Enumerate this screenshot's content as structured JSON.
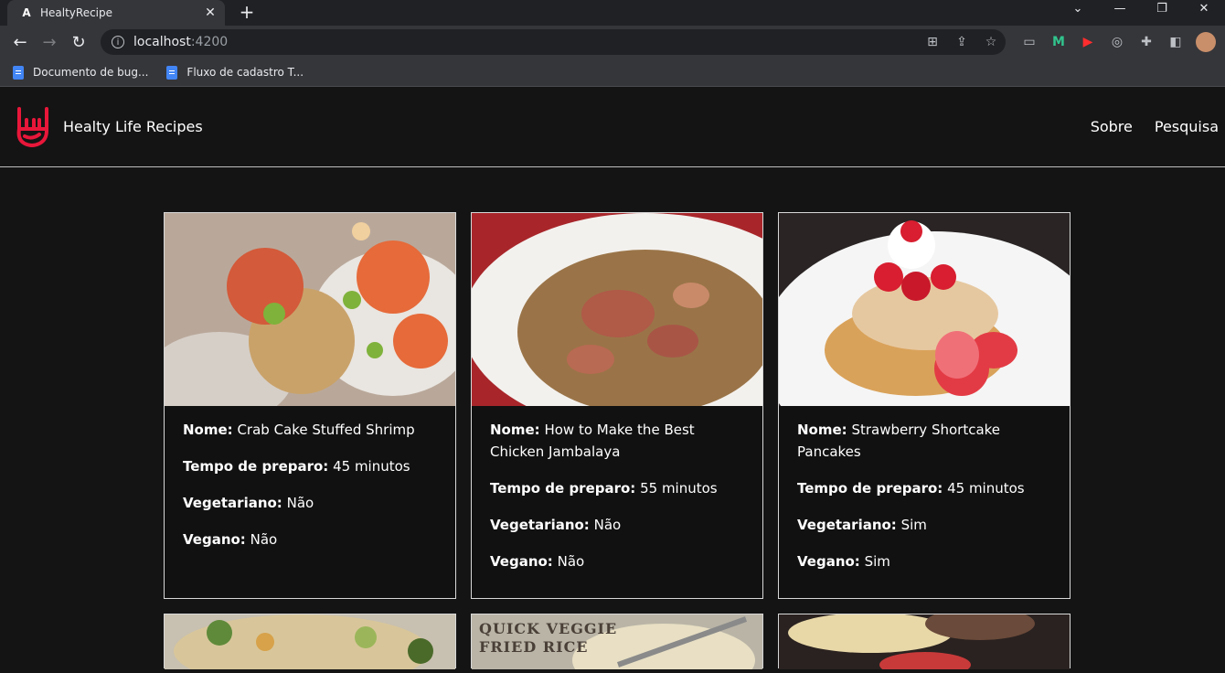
{
  "browser": {
    "tab_title": "HealtyRecipe",
    "url_host": "localhost",
    "url_port": ":4200",
    "bookmarks": [
      "Documento de bug...",
      "Fluxo de cadastro T..."
    ]
  },
  "header": {
    "brand": "Healty Life Recipes",
    "nav": [
      "Sobre",
      "Pesquisa"
    ]
  },
  "labels": {
    "name": "Nome:",
    "prep": "Tempo de preparo:",
    "veg": "Vegetariano:",
    "vegan": "Vegano:"
  },
  "recipes": [
    {
      "name": "Crab Cake Stuffed Shrimp",
      "prep_time": "45 minutos",
      "vegetarian": "Não",
      "vegan": "Não"
    },
    {
      "name": "How to Make the Best Chicken Jambalaya",
      "prep_time": "55 minutos",
      "vegetarian": "Não",
      "vegan": "Não"
    },
    {
      "name": "Strawberry Shortcake Pancakes",
      "prep_time": "45 minutos",
      "vegetarian": "Sim",
      "vegan": "Sim"
    }
  ],
  "partial_card_texts": [
    "QUICK VEGGIE",
    "FRIED RICE"
  ],
  "colors": {
    "accent": "#e8173a",
    "background": "#141414"
  }
}
